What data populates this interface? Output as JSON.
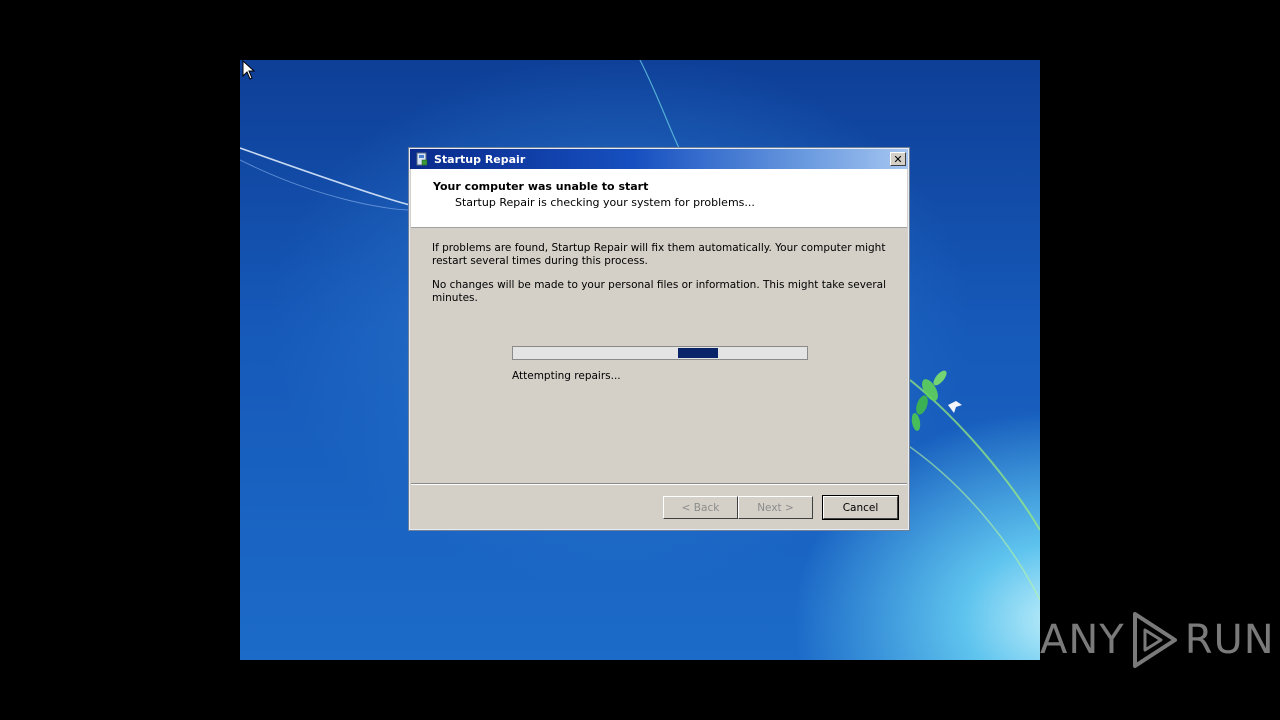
{
  "window": {
    "title": "Startup Repair",
    "close_glyph": "✕"
  },
  "header": {
    "title": "Your computer was unable to start",
    "subtitle": "Startup Repair is checking your system for problems..."
  },
  "body": {
    "paragraph1": "If problems are found, Startup Repair will fix them automatically. Your computer might restart several times during this process.",
    "paragraph2": "No changes will be made to your personal files or information. This might take several minutes."
  },
  "progress": {
    "mode": "marquee",
    "marquee_position": 0.63,
    "status": "Attempting repairs..."
  },
  "buttons": {
    "back": "< Back",
    "next": "Next >",
    "cancel": "Cancel"
  },
  "watermark": {
    "left": "ANY",
    "right": "RUN"
  },
  "colors": {
    "titlebar_start": "#0a2a8b",
    "titlebar_end": "#a6c6f0",
    "dialog_bg": "#d4d0c8",
    "progress_fill": "#0a246a"
  }
}
